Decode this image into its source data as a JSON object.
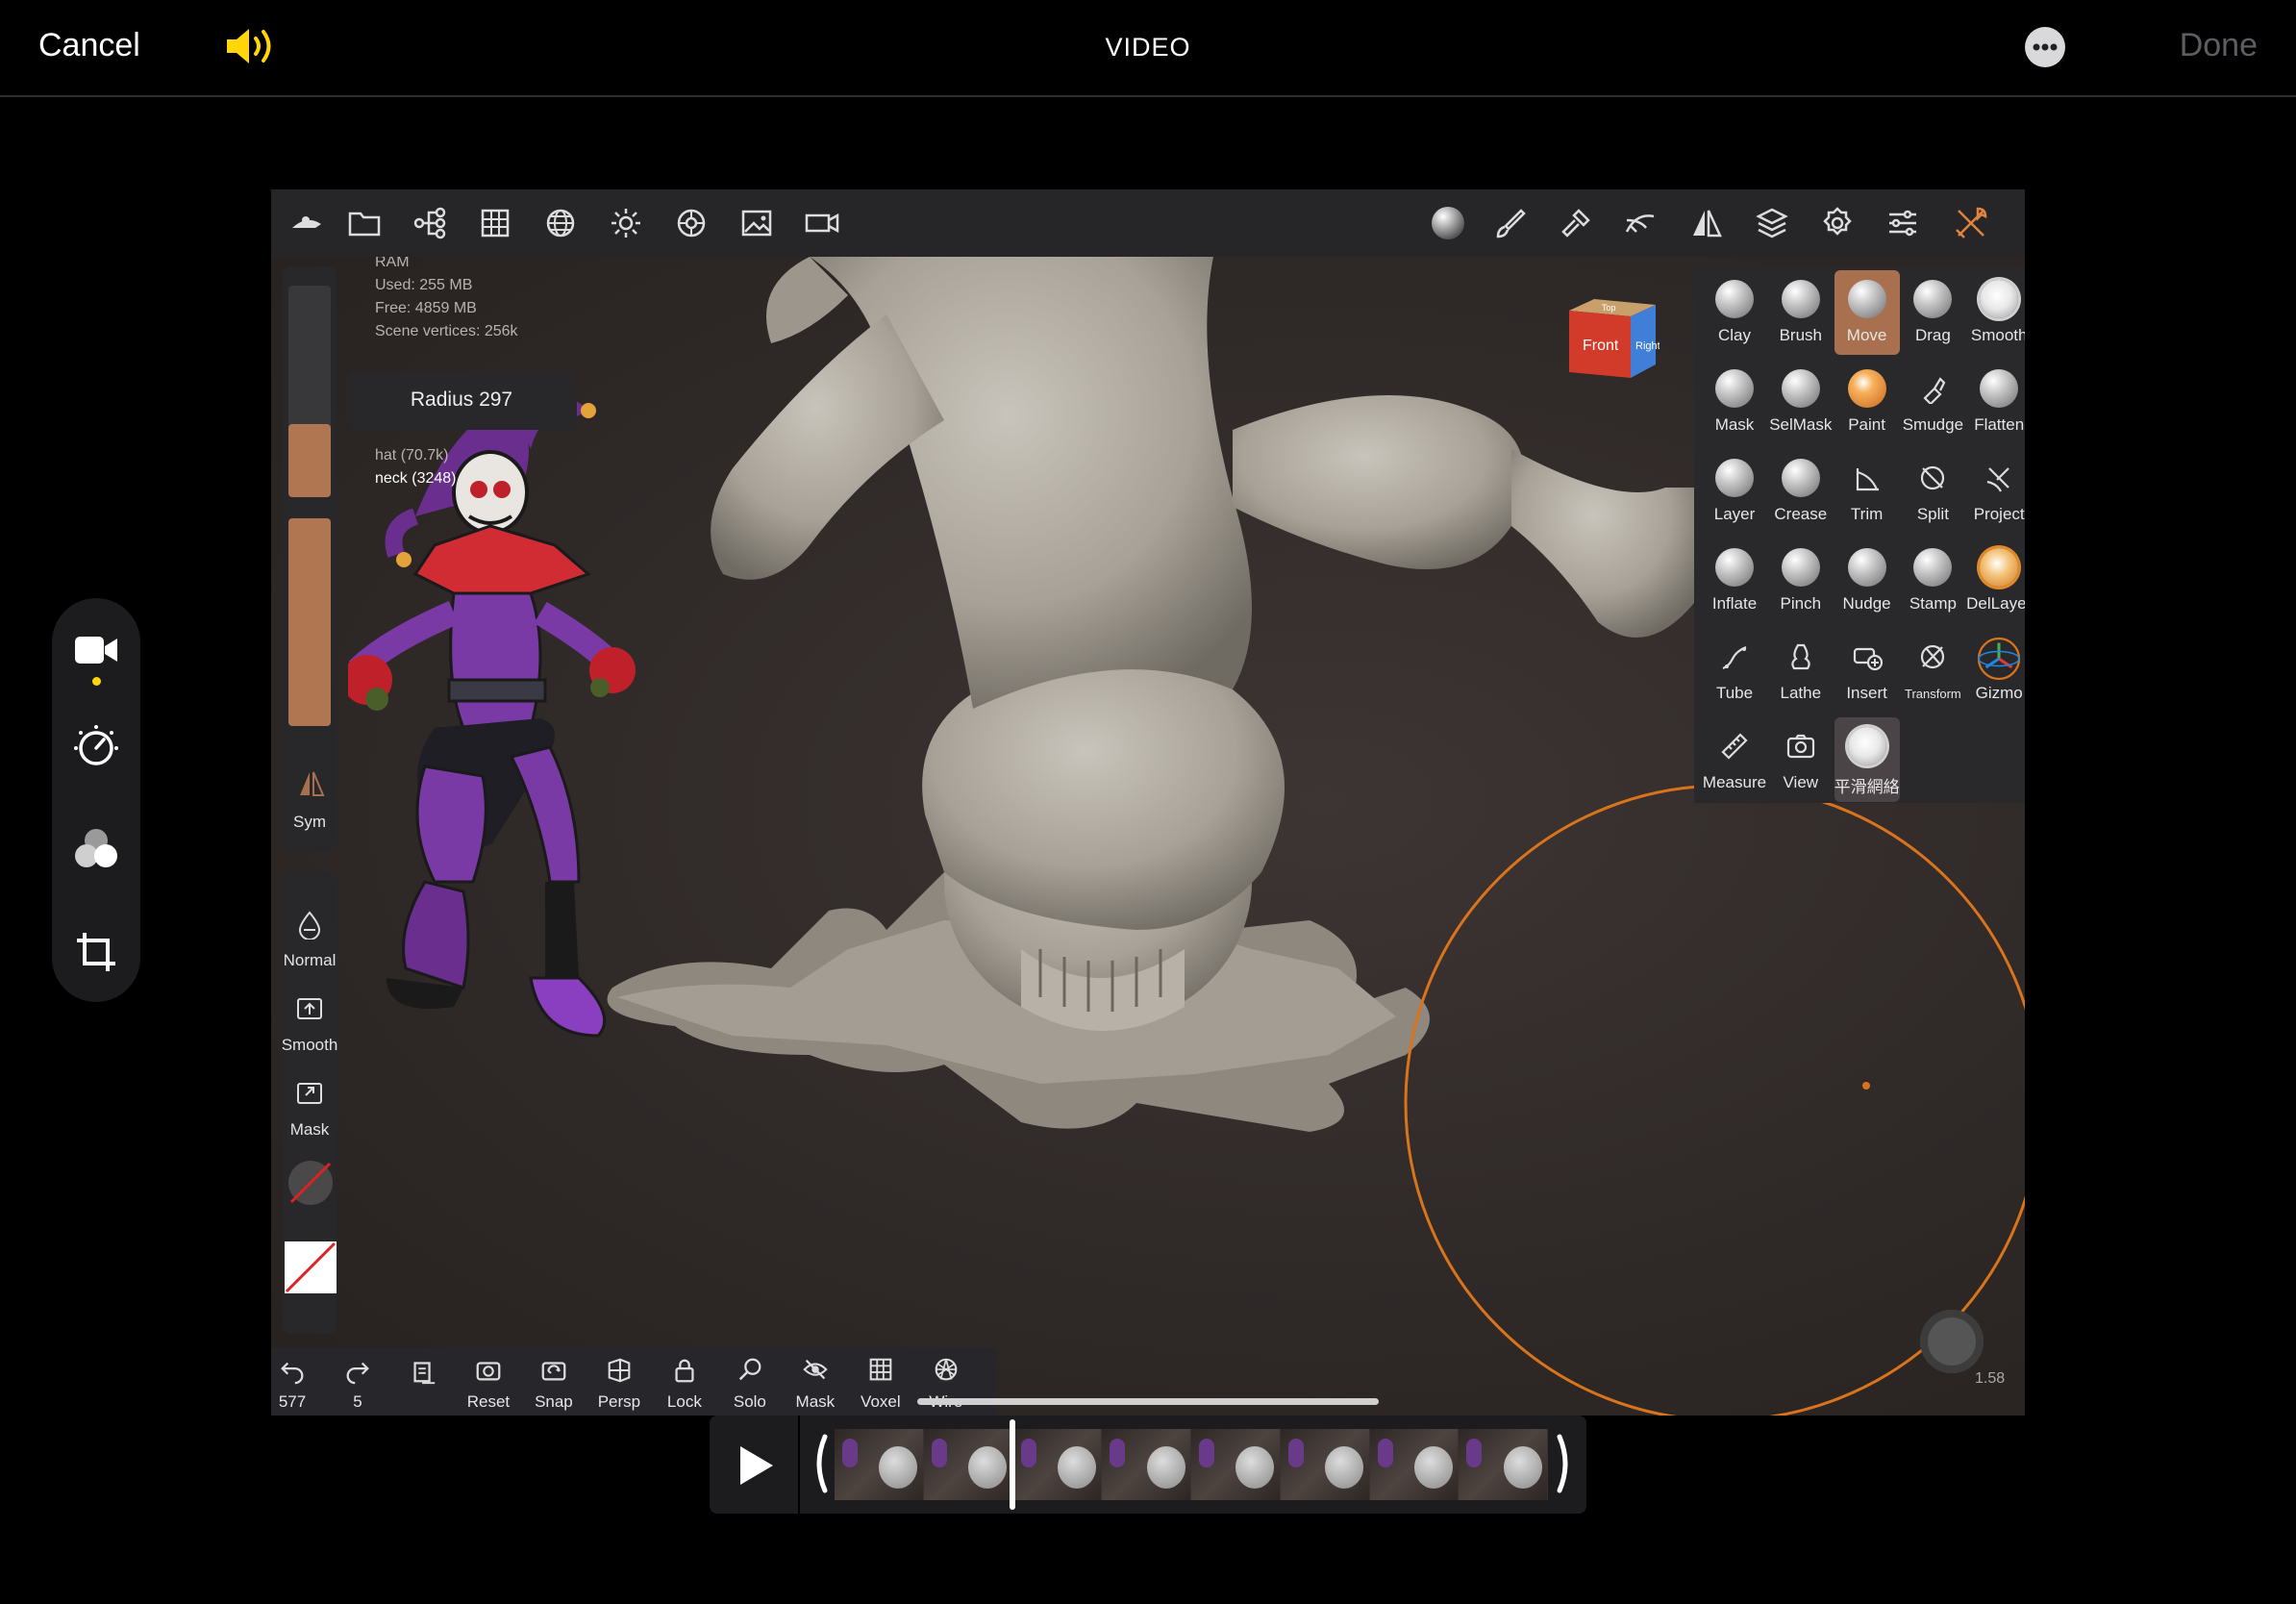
{
  "top_bar": {
    "cancel": "Cancel",
    "title": "VIDEO",
    "done": "Done"
  },
  "editor_panel": {
    "icons": [
      "video-camera-icon",
      "adjust-dial-icon",
      "filters-icon",
      "crop-rotate-icon"
    ]
  },
  "app": {
    "toolbar_left": [
      "menu-icon",
      "folder-icon",
      "scene-tree-icon",
      "grid-icon",
      "sphere-wireframe-icon",
      "light-icon",
      "material-icon",
      "image-icon",
      "camera-icon"
    ],
    "toolbar_right": [
      "matcap-icon",
      "paint-brush-icon",
      "hammer-icon",
      "stroke-icon",
      "symmetry-icon",
      "layers-icon",
      "settings-icon",
      "sliders-icon",
      "tools-icon"
    ],
    "info": {
      "ram": "RAM",
      "used": "Used: 255 MB",
      "free": "Free: 4859 MB",
      "vertices": "Scene vertices: 256k",
      "hat": "hat (70.7k)",
      "neck": "neck (3248)"
    },
    "radius_tooltip": "Radius 297",
    "sidebar": {
      "sym": "Sym",
      "normal": "Normal",
      "smooth": "Smooth",
      "mask": "Mask"
    },
    "view_cube": {
      "front": "Front",
      "right": "Right",
      "top": "Top"
    },
    "tools": [
      {
        "label": "Clay",
        "style": "ball"
      },
      {
        "label": "Brush",
        "style": "ball"
      },
      {
        "label": "Move",
        "style": "ball",
        "active": true
      },
      {
        "label": "Drag",
        "style": "ball"
      },
      {
        "label": "Smooth",
        "style": "fuzzy"
      },
      {
        "label": "Mask",
        "style": "ball"
      },
      {
        "label": "SelMask",
        "style": "ball"
      },
      {
        "label": "Paint",
        "style": "orange"
      },
      {
        "label": "Smudge",
        "style": "glyph"
      },
      {
        "label": "Flatten",
        "style": "ball"
      },
      {
        "label": "Layer",
        "style": "ball"
      },
      {
        "label": "Crease",
        "style": "ball"
      },
      {
        "label": "Trim",
        "style": "glyph"
      },
      {
        "label": "Split",
        "style": "glyph"
      },
      {
        "label": "Project",
        "style": "glyph"
      },
      {
        "label": "Inflate",
        "style": "ball"
      },
      {
        "label": "Pinch",
        "style": "ball"
      },
      {
        "label": "Nudge",
        "style": "ball"
      },
      {
        "label": "Stamp",
        "style": "ball"
      },
      {
        "label": "DelLayer",
        "style": "orange-fuzzy"
      },
      {
        "label": "Tube",
        "style": "glyph"
      },
      {
        "label": "Lathe",
        "style": "glyph"
      },
      {
        "label": "Insert",
        "style": "glyph"
      },
      {
        "label": "Transform",
        "style": "glyph",
        "small": true
      },
      {
        "label": "Gizmo",
        "style": "gizmo"
      },
      {
        "label": "Measure",
        "style": "glyph"
      },
      {
        "label": "View",
        "style": "glyph"
      },
      {
        "label": "平滑網絡",
        "style": "fuzzy",
        "active_light": true
      }
    ],
    "bottom_bar": [
      {
        "label": "577",
        "icon": "undo-icon"
      },
      {
        "label": "5",
        "icon": "redo-icon"
      },
      {
        "label": "",
        "icon": "history-icon"
      },
      {
        "label": "Reset",
        "icon": "reset-camera-icon"
      },
      {
        "label": "Snap",
        "icon": "snap-icon"
      },
      {
        "label": "Persp",
        "icon": "perspective-icon"
      },
      {
        "label": "Lock",
        "icon": "lock-icon"
      },
      {
        "label": "Solo",
        "icon": "search-icon"
      },
      {
        "label": "Mask",
        "icon": "eye-off-icon"
      },
      {
        "label": "Voxel",
        "icon": "voxel-grid-icon"
      },
      {
        "label": "Wire",
        "icon": "wireframe-icon"
      }
    ],
    "zoom_value": "1.58",
    "colors": {
      "accent": "#a8704f",
      "orange_ring": "#d9741c",
      "clay": "#b5afa6"
    }
  },
  "timeline": {
    "play_icon": "play-icon",
    "frames": 8
  }
}
